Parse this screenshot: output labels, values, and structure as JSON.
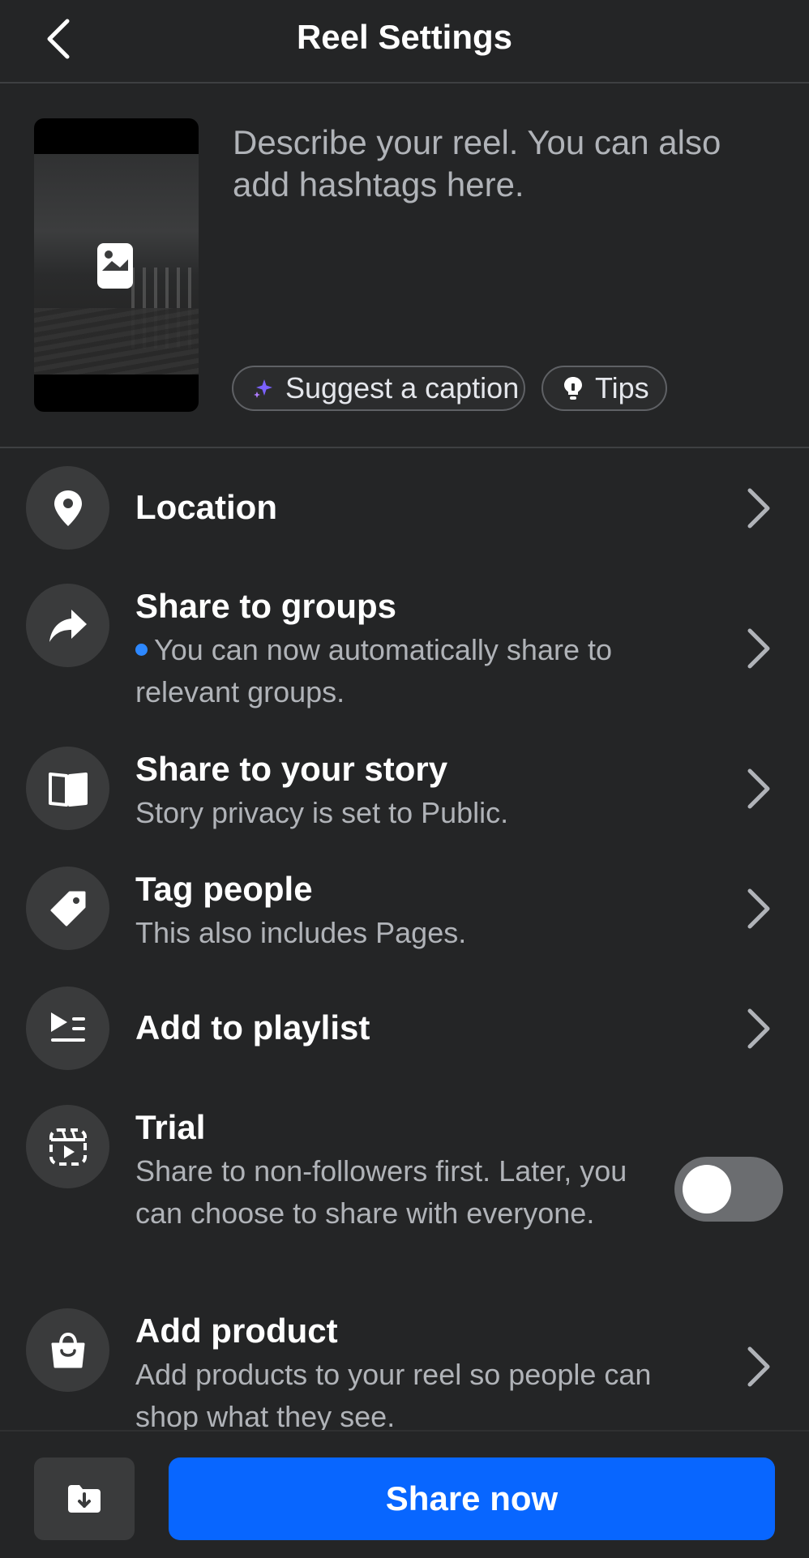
{
  "header": {
    "title": "Reel Settings",
    "back_icon": "back-arrow-icon"
  },
  "composer": {
    "placeholder": "Describe your reel. You can also add hashtags here.",
    "suggest_label": "Suggest a caption",
    "tips_label": "Tips"
  },
  "settings": [
    {
      "title": "Location",
      "subtitle": "",
      "icon": "location-pin-icon"
    },
    {
      "title": "Share to groups",
      "subtitle": "You can now automatically share to relevant groups.",
      "icon": "share-arrow-icon"
    },
    {
      "title": "Share to your story",
      "subtitle": "Story privacy is set to Public.",
      "icon": "book-icon"
    },
    {
      "title": "Tag people",
      "subtitle": "This also includes Pages.",
      "icon": "tag-icon"
    },
    {
      "title": "Add to playlist",
      "subtitle": "",
      "icon": "playlist-icon"
    },
    {
      "title": "Trial",
      "subtitle": "Share to non-followers first. Later, you can choose to share with everyone.",
      "icon": "trial-reel-icon",
      "toggle_on": false
    },
    {
      "title": "Add product",
      "subtitle": "Add products to your reel so people can shop what they see.",
      "icon": "shopping-bag-icon"
    }
  ],
  "footer": {
    "share_label": "Share now",
    "draft_icon": "save-draft-icon"
  },
  "colors": {
    "accent": "#0866ff",
    "new_dot": "#2d88ff",
    "background": "#242526"
  }
}
